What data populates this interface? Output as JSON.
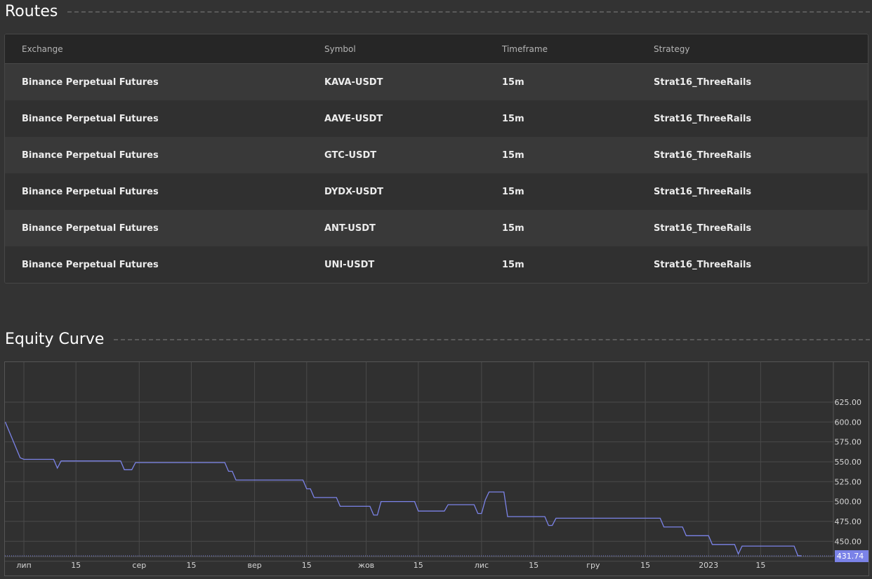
{
  "routes": {
    "title": "Routes",
    "columns": {
      "exchange": "Exchange",
      "symbol": "Symbol",
      "timeframe": "Timeframe",
      "strategy": "Strategy"
    },
    "rows": [
      {
        "exchange": "Binance Perpetual Futures",
        "symbol": "KAVA-USDT",
        "timeframe": "15m",
        "strategy": "Strat16_ThreeRails"
      },
      {
        "exchange": "Binance Perpetual Futures",
        "symbol": "AAVE-USDT",
        "timeframe": "15m",
        "strategy": "Strat16_ThreeRails"
      },
      {
        "exchange": "Binance Perpetual Futures",
        "symbol": "GTC-USDT",
        "timeframe": "15m",
        "strategy": "Strat16_ThreeRails"
      },
      {
        "exchange": "Binance Perpetual Futures",
        "symbol": "DYDX-USDT",
        "timeframe": "15m",
        "strategy": "Strat16_ThreeRails"
      },
      {
        "exchange": "Binance Perpetual Futures",
        "symbol": "ANT-USDT",
        "timeframe": "15m",
        "strategy": "Strat16_ThreeRails"
      },
      {
        "exchange": "Binance Perpetual Futures",
        "symbol": "UNI-USDT",
        "timeframe": "15m",
        "strategy": "Strat16_ThreeRails"
      }
    ]
  },
  "equity": {
    "title": "Equity Curve"
  },
  "colors": {
    "line": "#7b83e8",
    "last_value_badge": "#7b83e8",
    "grid": "#4a4a4a",
    "background": "#303030"
  },
  "chart_data": {
    "type": "line",
    "title": "Equity Curve",
    "xlabel": "",
    "ylabel": "",
    "ylim": [
      410,
      640
    ],
    "yticks": [
      "625.00",
      "600.00",
      "575.00",
      "550.00",
      "525.00",
      "500.00",
      "475.00",
      "450.00"
    ],
    "yticks_values": [
      625,
      600,
      575,
      550,
      525,
      500,
      475,
      450
    ],
    "xticks": [
      "лип",
      "15",
      "сер",
      "15",
      "вер",
      "15",
      "жов",
      "15",
      "лис",
      "15",
      "гру",
      "15",
      "2023",
      "15"
    ],
    "xticks_days": [
      0,
      14,
      31,
      45,
      62,
      76,
      92,
      106,
      123,
      137,
      153,
      167,
      184,
      198
    ],
    "x_start_label": "лип",
    "x_end_day": 226,
    "last_value": 431.74,
    "last_value_label": "431.74",
    "grid": true,
    "series": [
      {
        "points": [
          [
            -5,
            600
          ],
          [
            -1,
            555
          ],
          [
            0,
            553
          ],
          [
            8,
            553
          ],
          [
            9,
            542
          ],
          [
            10,
            551
          ],
          [
            26,
            551
          ],
          [
            27,
            540
          ],
          [
            29,
            540
          ],
          [
            30,
            549
          ],
          [
            54,
            549
          ],
          [
            55,
            538
          ],
          [
            56,
            538
          ],
          [
            57,
            527
          ],
          [
            75,
            527
          ],
          [
            76,
            516
          ],
          [
            77,
            516
          ],
          [
            78,
            505
          ],
          [
            84,
            505
          ],
          [
            85,
            494
          ],
          [
            93,
            494
          ],
          [
            94,
            483
          ],
          [
            95,
            483
          ],
          [
            96,
            500
          ],
          [
            105,
            500
          ],
          [
            106,
            488
          ],
          [
            113,
            488
          ],
          [
            114,
            496
          ],
          [
            121,
            496
          ],
          [
            122,
            485
          ],
          [
            123,
            485
          ],
          [
            124,
            502
          ],
          [
            125,
            512
          ],
          [
            129,
            512
          ],
          [
            130,
            481
          ],
          [
            140,
            481
          ],
          [
            141,
            470
          ],
          [
            142,
            470
          ],
          [
            143,
            479
          ],
          [
            171,
            479
          ],
          [
            172,
            468
          ],
          [
            177,
            468
          ],
          [
            178,
            457
          ],
          [
            184,
            457
          ],
          [
            185,
            446
          ],
          [
            191,
            446
          ],
          [
            192,
            434
          ],
          [
            193,
            444
          ],
          [
            207,
            444
          ],
          [
            208,
            432
          ],
          [
            209,
            431.74
          ]
        ]
      }
    ]
  }
}
